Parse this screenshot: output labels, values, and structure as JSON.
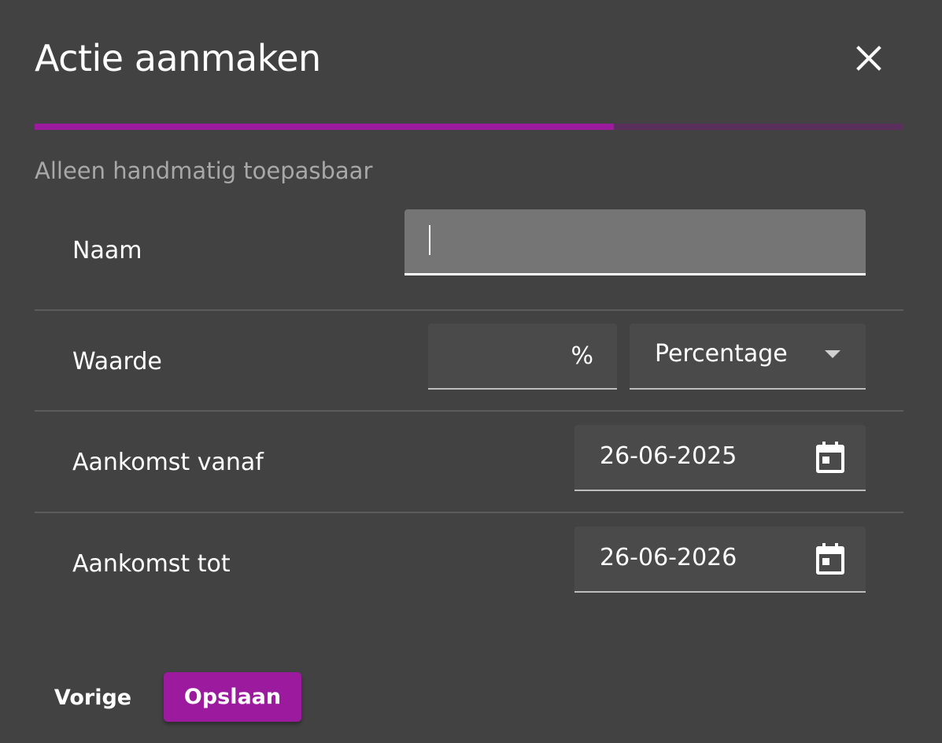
{
  "dialog": {
    "title": "Actie aanmaken",
    "subtitle": "Alleen handmatig toepasbaar",
    "close_icon": "close-icon",
    "progress": 0.667
  },
  "colors": {
    "accent": "#9c1a9e",
    "progress_track": "#5a2f5c",
    "background": "#424242"
  },
  "form": {
    "name": {
      "label": "Naam",
      "value": ""
    },
    "value": {
      "label": "Waarde",
      "amount": "",
      "suffix": "%",
      "type_selected": "Percentage",
      "arrow_icon": "dropdown-arrow-icon"
    },
    "arrival_from": {
      "label": "Aankomst vanaf",
      "value": "26-06-2025",
      "icon": "calendar-icon"
    },
    "arrival_to": {
      "label": "Aankomst tot",
      "value": "26-06-2026",
      "icon": "calendar-icon"
    }
  },
  "actions": {
    "previous_label": "Vorige",
    "save_label": "Opslaan"
  }
}
